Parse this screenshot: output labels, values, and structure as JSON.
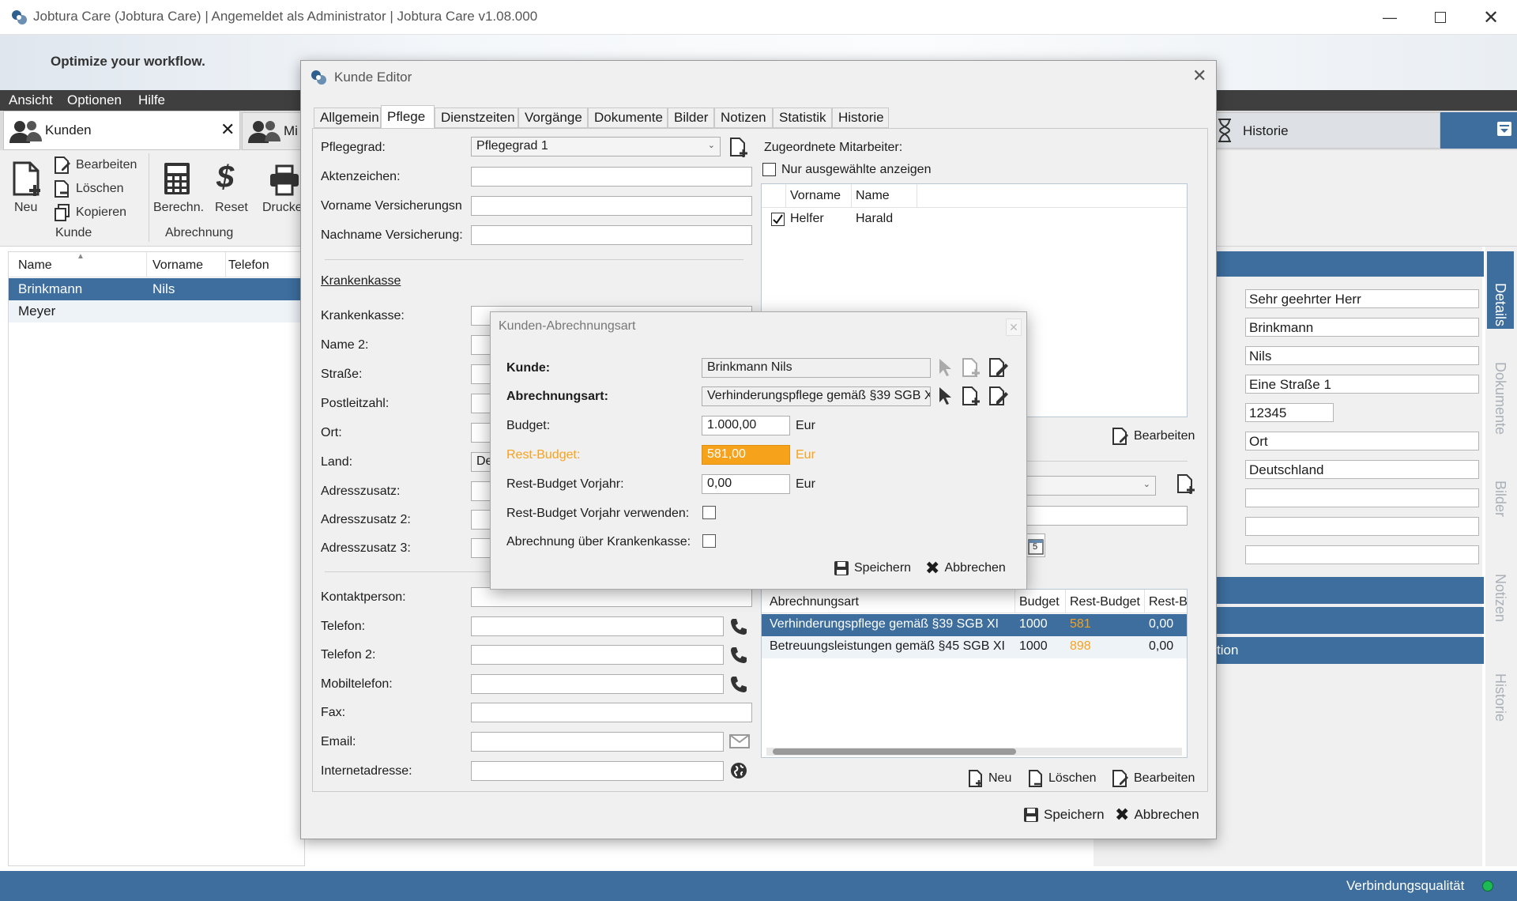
{
  "window": {
    "title": "Jobtura Care (Jobtura Care) | Angemeldet als Administrator | Jobtura Care v1.08.000"
  },
  "banner": {
    "tagline": "Optimize your workflow."
  },
  "menu": [
    "Ansicht",
    "Optionen",
    "Hilfe"
  ],
  "shell_tabs": {
    "kunden": "Kunden",
    "mitarbeiter": "Mi",
    "historie": "Historie"
  },
  "ribbon": {
    "neu": "Neu",
    "bearbeiten": "Bearbeiten",
    "loeschen": "Löschen",
    "kopieren": "Kopieren",
    "berechn": "Berechn.",
    "reset": "Reset",
    "drucken": "Drucke",
    "group_kunde": "Kunde",
    "group_abrechnung": "Abrechnung"
  },
  "customer_list": {
    "headers": [
      "Name",
      "Vorname",
      "Telefon"
    ],
    "rows": [
      [
        "Brinkmann",
        "Nils",
        ""
      ],
      [
        "Meyer",
        "",
        ""
      ]
    ]
  },
  "details_panel": {
    "fields": [
      "Sehr geehrter Herr",
      "Brinkmann",
      "Nils",
      "Eine Straße 1",
      "12345",
      "Ort",
      "Deutschland",
      "",
      "",
      ""
    ],
    "bar_text": "tion"
  },
  "side_tabs": [
    "Details",
    "Dokumente",
    "Bilder",
    "Notizen",
    "Historie"
  ],
  "status": {
    "connection": "Verbindungsqualität",
    "connection_color": "#1db954"
  },
  "editor": {
    "title": "Kunde Editor",
    "tabs": [
      "Allgemein",
      "Pflege",
      "Dienstzeiten",
      "Vorgänge",
      "Dokumente",
      "Bilder",
      "Notizen",
      "Statistik",
      "Historie"
    ],
    "active_tab": "Pflege",
    "left": {
      "pflegegrad_label": "Pflegegrad:",
      "pflegegrad_value": "Pflegegrad 1",
      "aktenzeichen_label": "Aktenzeichen:",
      "vorname_vers_label": "Vorname Versicherungsn",
      "nachname_vers_label": "Nachname Versicherung:",
      "krankenkasse_section": "Krankenkasse",
      "krankenkasse_label": "Krankenkasse:",
      "name2_label": "Name 2:",
      "strasse_label": "Straße:",
      "plz_label": "Postleitzahl:",
      "ort_label": "Ort:",
      "land_label": "Land:",
      "land_value": "De",
      "adresszusatz_label": "Adresszusatz:",
      "adresszusatz2_label": "Adresszusatz 2:",
      "adresszusatz3_label": "Adresszusatz 3:",
      "kontaktperson_label": "Kontaktperson:",
      "telefon_label": "Telefon:",
      "telefon2_label": "Telefon 2:",
      "mobil_label": "Mobiltelefon:",
      "fax_label": "Fax:",
      "email_label": "Email:",
      "internet_label": "Internetadresse:"
    },
    "right": {
      "zugeordnete_label": "Zugeordnete Mitarbeiter:",
      "nur_ausgewaehlte": "Nur ausgewählte anzeigen",
      "staff_headers": [
        "Vorname",
        "Name"
      ],
      "staff_rows": [
        {
          "checked": true,
          "vorname": "Helfer",
          "name": "Harald"
        }
      ],
      "bearbeiten": "Bearbeiten",
      "billing_headers": [
        "Abrechnungsart",
        "Budget",
        "Rest-Budget",
        "Rest-Bu"
      ],
      "billing_rows": [
        {
          "art": "Verhinderungspflege gemäß §39 SGB XI",
          "budget": "1000",
          "rest": "581",
          "rest_vj": "0,00"
        },
        {
          "art": "Betreuungsleistungen gemäß §45 SGB XI",
          "budget": "1000",
          "rest": "898",
          "rest_vj": "0,00"
        }
      ],
      "neu": "Neu",
      "loeschen": "Löschen",
      "bearbeiten2": "Bearbeiten",
      "calendar_digit": "5"
    },
    "speichern": "Speichern",
    "abbrechen": "Abbrechen"
  },
  "dialog": {
    "title": "Kunden-Abrechnungsart",
    "kunde_label": "Kunde:",
    "kunde_value": "Brinkmann Nils",
    "art_label": "Abrechnungsart:",
    "art_value": "Verhinderungspflege gemäß §39 SGB X",
    "budget_label": "Budget:",
    "budget_value": "1.000,00",
    "rest_label": "Rest-Budget:",
    "rest_value": "581,00",
    "rest_vj_label": "Rest-Budget Vorjahr:",
    "rest_vj_value": "0,00",
    "currency": "Eur",
    "use_vj_label": "Rest-Budget Vorjahr verwenden:",
    "krankenkasse_label": "Abrechnung über Krankenkasse:",
    "speichern": "Speichern",
    "abbrechen": "Abbrechen",
    "highlight_color": "#f7a21b"
  }
}
